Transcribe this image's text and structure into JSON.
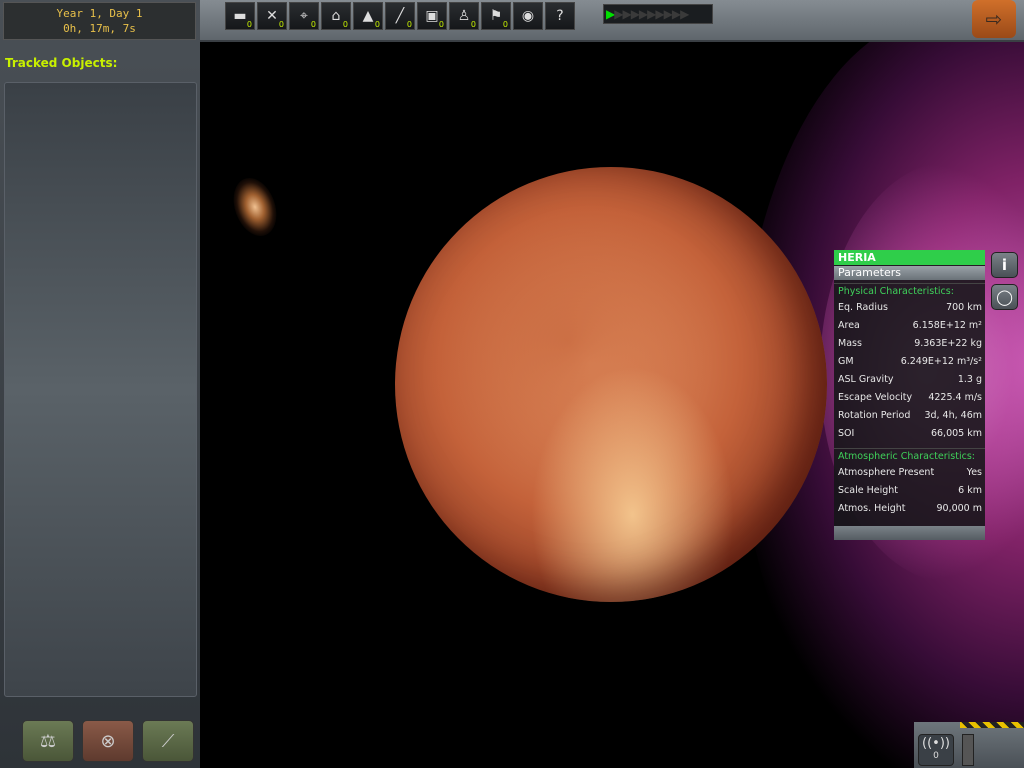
{
  "clock": {
    "date": "Year 1, Day 1",
    "time": "0h, 17m, 7s"
  },
  "sidebar": {
    "tracked_label": "Tracked Objects:"
  },
  "toolbar": {
    "filters": [
      {
        "name": "debris",
        "glyph": "▬",
        "count": "0"
      },
      {
        "name": "probes",
        "glyph": "✕",
        "count": "0"
      },
      {
        "name": "rovers",
        "glyph": "⌖",
        "count": "0"
      },
      {
        "name": "landers",
        "glyph": "⌂",
        "count": "0"
      },
      {
        "name": "ships",
        "glyph": "▲",
        "count": "0"
      },
      {
        "name": "stations",
        "glyph": "╱",
        "count": "0"
      },
      {
        "name": "bases",
        "glyph": "▣",
        "count": "0"
      },
      {
        "name": "eva",
        "glyph": "♙",
        "count": "0"
      },
      {
        "name": "flags",
        "glyph": "⚑",
        "count": "0"
      },
      {
        "name": "space-objects",
        "glyph": "◉",
        "count": ""
      },
      {
        "name": "help",
        "glyph": "?",
        "count": ""
      }
    ],
    "timewarp": {
      "active": "▶",
      "inactive": "▶▶▶▶▶▶▶▶▶"
    }
  },
  "body_info": {
    "name": "HERIA",
    "tab": "Parameters",
    "physical_heading": "Physical Characteristics:",
    "physical": [
      {
        "label": "Eq. Radius",
        "value": "700 km"
      },
      {
        "label": "Area",
        "value": "6.158E+12 m²"
      },
      {
        "label": "Mass",
        "value": "9.363E+22 kg"
      },
      {
        "label": "GM",
        "value": "6.249E+12 m³/s²"
      },
      {
        "label": "ASL Gravity",
        "value": "1.3 g"
      },
      {
        "label": "Escape Velocity",
        "value": "4225.4 m/s"
      },
      {
        "label": "Rotation Period",
        "value": "3d, 4h, 46m"
      },
      {
        "label": "SOI",
        "value": "66,005 km"
      }
    ],
    "atmo_heading": "Atmospheric Characteristics:",
    "atmosphere": [
      {
        "label": "Atmosphere Present",
        "value": "Yes"
      },
      {
        "label": "Scale Height",
        "value": "6 km"
      },
      {
        "label": "Atmos. Height",
        "value": "90,000 m"
      }
    ],
    "side_buttons": {
      "info": "i",
      "orbit": "◯"
    }
  },
  "bottom": {
    "signal_count": "0"
  },
  "colors": {
    "accent_green": "#2fce4a",
    "label_yellow": "#c8f000",
    "exit_orange": "#d0702a"
  }
}
